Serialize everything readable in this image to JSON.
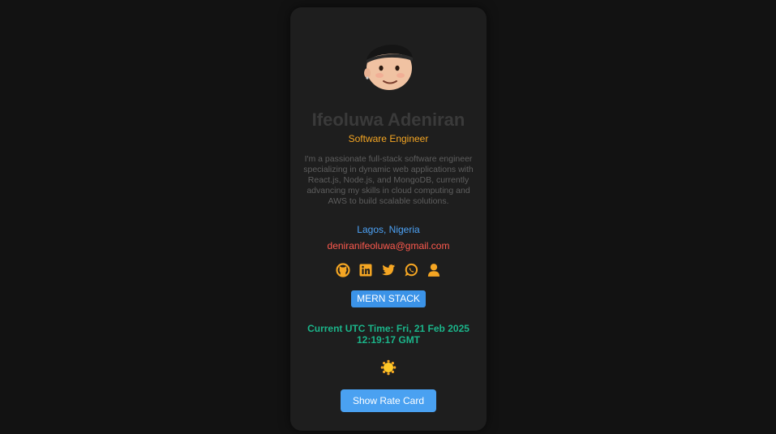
{
  "profile": {
    "name": "Ifeoluwa Adeniran",
    "title": "Software Engineer",
    "bio": "I'm a passionate full-stack software engineer specializing in dynamic web applications with React.js, Node.js, and MongoDB, currently advancing my skills in cloud computing and AWS to build scalable solutions.",
    "location": "Lagos, Nigeria",
    "email": "deniranifeoluwa@gmail.com"
  },
  "socials": [
    "github-icon",
    "linkedin-icon",
    "twitter-icon",
    "whatsapp-icon",
    "user-icon"
  ],
  "badge": "MERN STACK",
  "time": {
    "line1": "Current UTC Time: Fri, 21 Feb 2025",
    "line2": "12:19:17 GMT"
  },
  "theme_toggle": "sun-icon",
  "actions": {
    "rate_card_label": "Show Rate Card"
  },
  "colors": {
    "background": "#121212",
    "card": "#1e1e1e",
    "accent_orange": "#f5a623",
    "link_blue": "#4da3f7",
    "email_red": "#ff5a4e",
    "time_green": "#1bb58a",
    "button_blue": "#4aa1f1"
  }
}
